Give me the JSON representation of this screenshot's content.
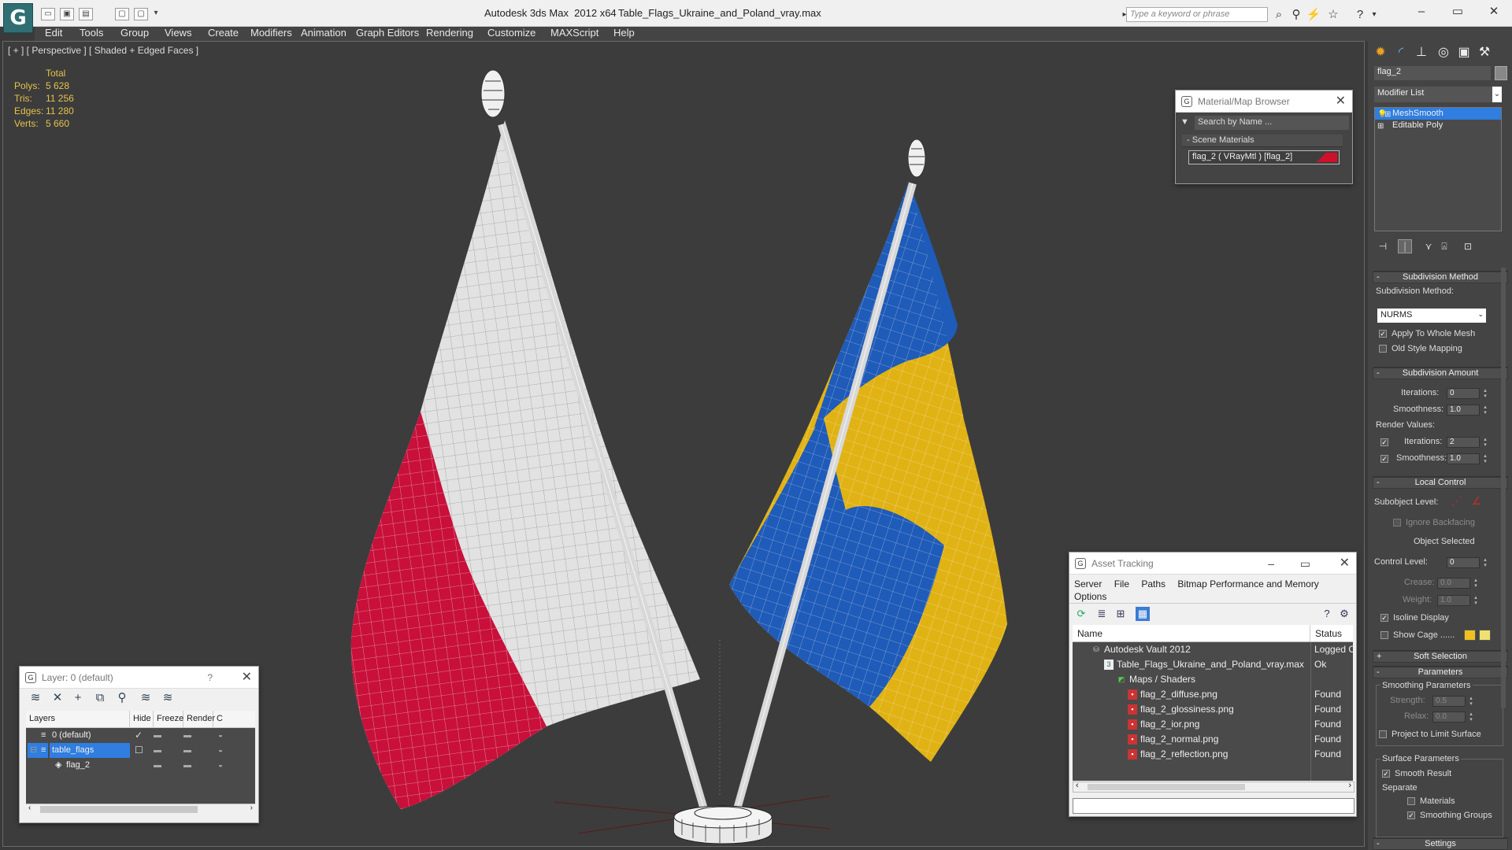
{
  "titlebar": {
    "app_title": "Autodesk 3ds Max  2012 x64",
    "file_name": "Table_Flags_Ukraine_and_Poland_vray.max",
    "search_placeholder": "Type a keyword or phrase"
  },
  "menu": [
    "Edit",
    "Tools",
    "Group",
    "Views",
    "Create",
    "Modifiers",
    "Animation",
    "Graph Editors",
    "Rendering",
    "Customize",
    "MAXScript",
    "Help"
  ],
  "viewport": {
    "label": "[ + ] [ Perspective ] [ Shaded + Edged Faces ]",
    "stats": {
      "header": "Total",
      "rows": [
        {
          "k": "Polys:",
          "v": "5 628"
        },
        {
          "k": "Tris:",
          "v": "11 256"
        },
        {
          "k": "Edges:",
          "v": "11 280"
        },
        {
          "k": "Verts:",
          "v": "5 660"
        }
      ]
    },
    "colors": {
      "poland_red": "#c8103a",
      "poland_white": "#e4e4e4",
      "ukraine_blue": "#1f5bb8",
      "ukraine_yellow": "#e4b414",
      "background": "#3c3c3c"
    }
  },
  "material_browser": {
    "title": "Material/Map Browser",
    "search_placeholder": "Search by Name ...",
    "section": "Scene Materials",
    "item": "flag_2  ( VRayMtl )  [flag_2]"
  },
  "layer_window": {
    "title": "Layer: 0 (default)",
    "help": "?",
    "columns": [
      "Layers",
      "Hide",
      "Freeze",
      "Render",
      "C"
    ],
    "rows": [
      {
        "name": "0 (default)",
        "active": true
      },
      {
        "name": "table_flags",
        "selected": true
      },
      {
        "name": "flag_2"
      }
    ]
  },
  "asset_tracking": {
    "title": "Asset Tracking",
    "menu": [
      "Server",
      "File",
      "Paths",
      "Bitmap Performance and Memory",
      "Options"
    ],
    "columns": {
      "name": "Name",
      "status": "Status"
    },
    "rows": [
      {
        "name": "Autodesk Vault 2012",
        "status": "Logged O"
      },
      {
        "name": "Table_Flags_Ukraine_and_Poland_vray.max",
        "status": "Ok"
      },
      {
        "name": "Maps / Shaders",
        "status": ""
      },
      {
        "name": "flag_2_diffuse.png",
        "status": "Found"
      },
      {
        "name": "flag_2_glossiness.png",
        "status": "Found"
      },
      {
        "name": "flag_2_ior.png",
        "status": "Found"
      },
      {
        "name": "flag_2_normal.png",
        "status": "Found"
      },
      {
        "name": "flag_2_reflection.png",
        "status": "Found"
      }
    ]
  },
  "command_panel": {
    "object_name": "flag_2",
    "modifier_list": "Modifier List",
    "stack": [
      "MeshSmooth",
      "Editable Poly"
    ],
    "subdivision_method": {
      "title": "Subdivision Method",
      "label": "Subdivision Method:",
      "value": "NURMS",
      "apply_whole_mesh": "Apply To Whole Mesh",
      "old_style_mapping": "Old Style Mapping"
    },
    "subdivision_amount": {
      "title": "Subdivision Amount",
      "iterations_label": "Iterations:",
      "iterations": "0",
      "smoothness_label": "Smoothness:",
      "smoothness": "1.0",
      "render_values": "Render Values:",
      "render_iterations": "2",
      "render_smoothness": "1.0"
    },
    "local_control": {
      "title": "Local Control",
      "subobject_level": "Subobject Level:",
      "ignore_backfacing": "Ignore Backfacing",
      "object_selected": "Object Selected",
      "control_level_label": "Control Level:",
      "control_level": "0",
      "crease_label": "Crease:",
      "crease": "0.0",
      "weight_label": "Weight:",
      "weight": "1.0",
      "isoline_display": "Isoline Display",
      "show_cage": "Show Cage ......"
    },
    "soft_selection": "Soft Selection",
    "parameters": {
      "title": "Parameters",
      "smoothing_params": "Smoothing Parameters",
      "strength_label": "Strength:",
      "strength": "0.5",
      "relax_label": "Relax:",
      "relax": "0.0",
      "project_limit": "Project to Limit Surface",
      "surface_params": "Surface Parameters",
      "smooth_result": "Smooth Result",
      "separate": "Separate",
      "materials": "Materials",
      "smoothing_groups": "Smoothing Groups"
    },
    "settings": "Settings"
  }
}
